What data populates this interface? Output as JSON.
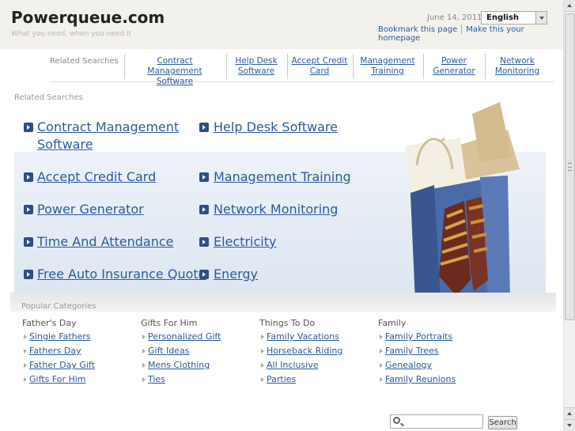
{
  "header": {
    "site_title": "Powerqueue.com",
    "tagline": "What you need, when you need it",
    "date": "June 14, 2011",
    "language": "English",
    "bookmark_label": "Bookmark this page",
    "homepage_label": "Make this your homepage"
  },
  "topbar": {
    "label": "Related Searches",
    "items": [
      {
        "line1": "Contract Management",
        "line2": "Software"
      },
      {
        "line1": "Help Desk",
        "line2": "Software"
      },
      {
        "line1": "Accept Credit",
        "line2": "Card"
      },
      {
        "line1": "Management",
        "line2": "Training"
      },
      {
        "line1": "Power",
        "line2": "Generator"
      },
      {
        "line1": "Network",
        "line2": "Monitoring"
      }
    ]
  },
  "related": {
    "label": "Related Searches",
    "links": [
      {
        "line1": "Contract Management",
        "line2": "Software"
      },
      {
        "line1": "Help Desk Software"
      },
      {
        "line1": "Accept Credit Card"
      },
      {
        "line1": "Management Training"
      },
      {
        "line1": "Power Generator"
      },
      {
        "line1": "Network Monitoring"
      },
      {
        "line1": "Time And Attendance"
      },
      {
        "line1": "Electricity"
      },
      {
        "line1": "Free Auto Insurance Quote"
      },
      {
        "line1": "Energy"
      }
    ]
  },
  "popular": {
    "label": "Popular Categories",
    "columns": [
      {
        "heading": "Father's Day",
        "items": [
          "Single Fathers",
          "Fathers Day",
          "Father Day Gift",
          "Gifts For Him"
        ]
      },
      {
        "heading": "Gifts For Him",
        "items": [
          "Personalized Gift",
          "Gift Ideas",
          "Mens Clothing",
          "Ties"
        ]
      },
      {
        "heading": "Things To Do",
        "items": [
          "Family Vacations",
          "Horseback Riding",
          "All Inclusive",
          "Parties"
        ]
      },
      {
        "heading": "Family",
        "items": [
          "Family Portraits",
          "Family Trees",
          "Genealogy",
          "Family Reunions"
        ]
      }
    ]
  },
  "search": {
    "value": "",
    "button_label": "Search"
  }
}
